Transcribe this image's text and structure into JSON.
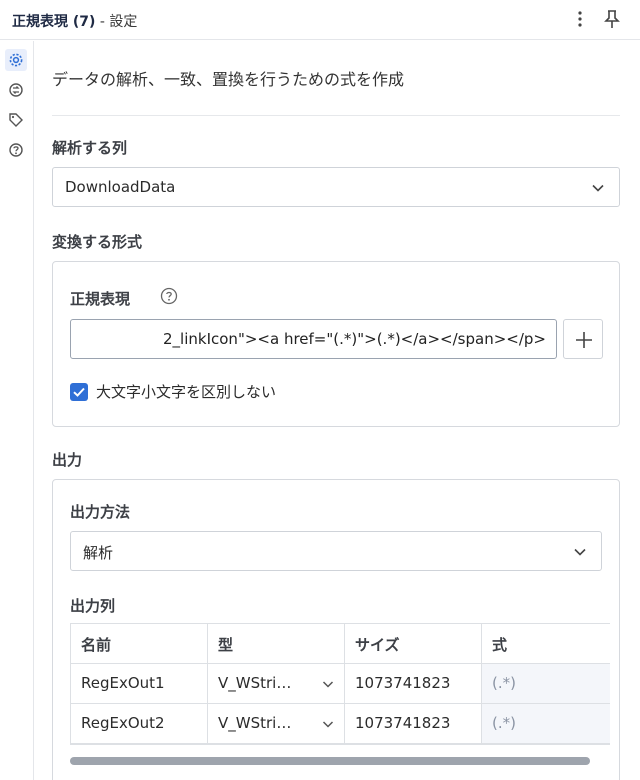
{
  "header": {
    "title": "正規表現 (7)",
    "subtitle": " - 設定",
    "menu_icon": "kebab-icon",
    "pin_icon": "pin-icon"
  },
  "rail": {
    "icons": [
      "gear-icon",
      "connection-icon",
      "tag-icon",
      "help-icon"
    ]
  },
  "description": "データの解析、一致、置換を行うための式を作成",
  "parse_column": {
    "label": "解析する列",
    "value": "DownloadData"
  },
  "format": {
    "label": "変換する形式",
    "regex_label": "正規表現",
    "regex_value": "2_linkIcon\"><a href=\"(.*)\">(.*)</a></span></p>",
    "case_insensitive_label": "大文字小文字を区別しない",
    "case_insensitive_checked": true
  },
  "output": {
    "label": "出力",
    "method_label": "出力方法",
    "method_value": "解析",
    "columns_label": "出力列",
    "table": {
      "headers": [
        "名前",
        "型",
        "サイズ",
        "式"
      ],
      "rows": [
        {
          "name": "RegExOut1",
          "type": "V_WStri…",
          "size": "1073741823",
          "expr": "(.*)"
        },
        {
          "name": "RegExOut2",
          "type": "V_WStri…",
          "size": "1073741823",
          "expr": "(.*)"
        }
      ]
    }
  },
  "colors": {
    "accent": "#2f6fd6",
    "border": "#cfd3d9",
    "muted_text": "#8a93a3"
  }
}
